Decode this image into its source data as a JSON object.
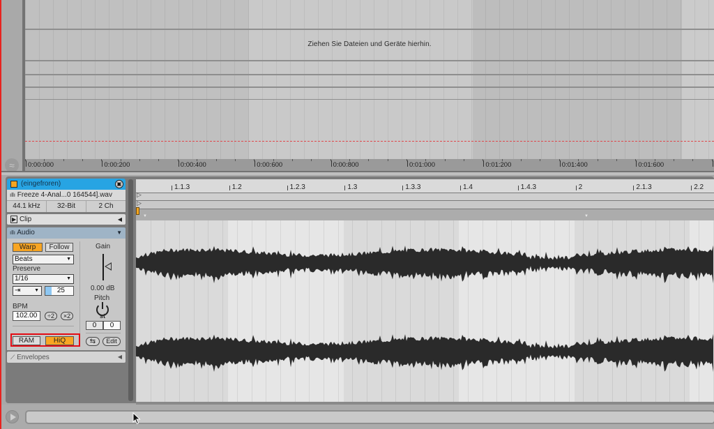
{
  "arrangement": {
    "drop_hint": "Ziehen Sie Dateien und Geräte hierhin.",
    "time_ruler": [
      "0:00:000",
      "0:00:200",
      "0:00:400",
      "0:00:600",
      "0:00:800",
      "0:01:000",
      "0:01:200",
      "0:01:400",
      "0:01:600"
    ],
    "waveform_toggle_icon": "≈"
  },
  "clip_panel": {
    "clip_name": "(eingefroren)",
    "clip_color": "#f3a521",
    "header_color": "#27a4e3",
    "save_icon": "▣",
    "file_name": "Freeze 4-Anal...0 164544].wav",
    "file_icon": "ıllı",
    "sample_rate": "44.1 kHz",
    "bit_depth": "32-Bit",
    "channels": "2 Ch",
    "clip_section": {
      "label": "Clip",
      "icon": "▶",
      "collapse_icon": "◀"
    },
    "audio_section": {
      "label": "Audio",
      "icon": "ıllı",
      "expand_icon": "▼"
    },
    "warp_label": "Warp",
    "warp_on": true,
    "follow_label": "Follow",
    "warp_mode": "Beats",
    "preserve_label": "Preserve",
    "preserve_value": "1/16",
    "transient_loop_mode_icon": "⇥",
    "transient_envelope": "25",
    "bpm_label": "BPM",
    "bpm_value": "102.00",
    "half_label": "÷2",
    "double_label": "×2",
    "ram_label": "RAM",
    "hiq_label": "HiQ",
    "hiq_on": true,
    "gain_label": "Gain",
    "gain_value": "0.00 dB",
    "pitch_label": "Pitch",
    "pitch_unit": "st",
    "pitch_semitones": "0",
    "pitch_cents": "0",
    "reverse_icon": "⇆",
    "edit_label": "Edit",
    "envelopes_section": {
      "label": "Envelopes",
      "collapse_icon": "◀"
    },
    "highlight_color": "#e40b13"
  },
  "sample_editor": {
    "beat_ruler": [
      "1.1.3",
      "1.2",
      "1.2.3",
      "1.3",
      "1.3.3",
      "1.4",
      "1.4.3",
      "2",
      "2.1.3",
      "2.2"
    ],
    "waveform_color": "#2a2a2a"
  }
}
